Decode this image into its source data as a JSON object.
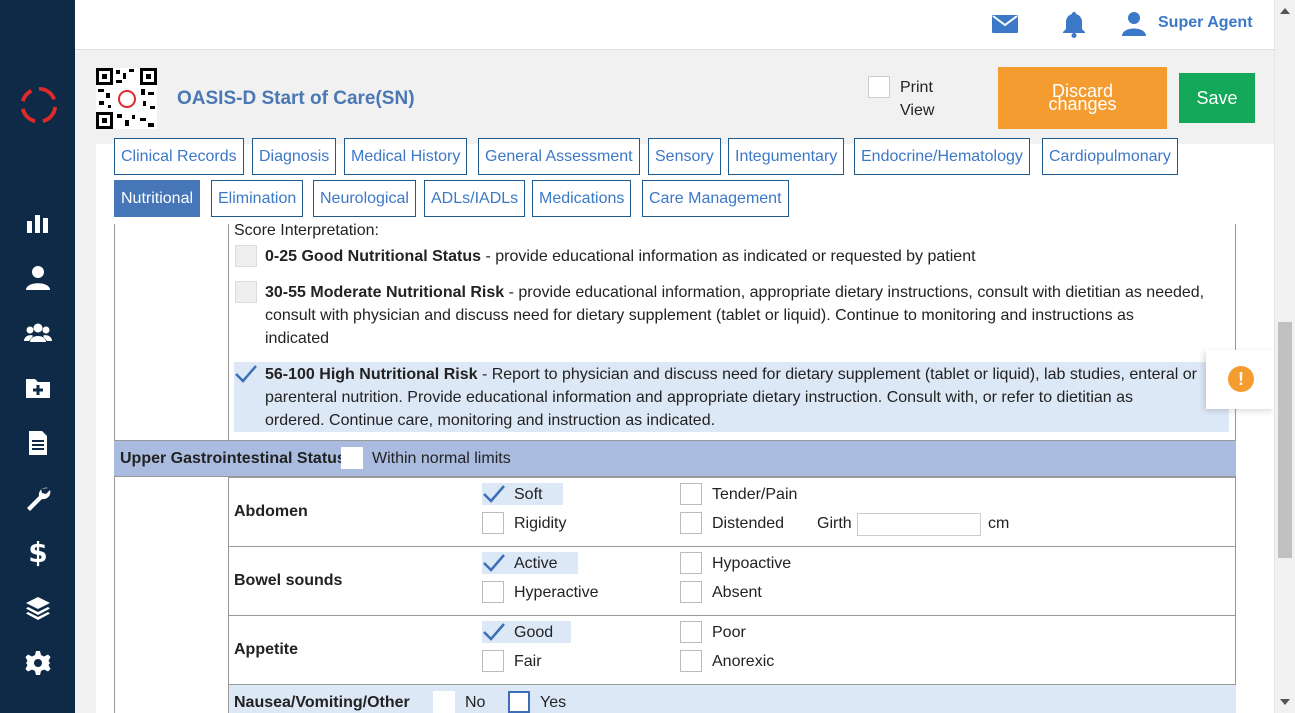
{
  "header": {
    "user_name": "Super Agent"
  },
  "form": {
    "title": "OASIS-D Start of Care(SN)",
    "print_view_label_1": "Print",
    "print_view_label_2": "View",
    "discard_label": "Discard changes",
    "save_label": "Save"
  },
  "tabs": [
    {
      "label": "Clinical Records"
    },
    {
      "label": "Diagnosis"
    },
    {
      "label": "Medical History"
    },
    {
      "label": "General Assessment"
    },
    {
      "label": "Sensory"
    },
    {
      "label": "Integumentary"
    },
    {
      "label": "Endocrine/Hematology"
    },
    {
      "label": "Cardiopulmonary"
    },
    {
      "label": "Nutritional",
      "active": true
    },
    {
      "label": "Elimination"
    },
    {
      "label": "Neurological"
    },
    {
      "label": "ADLs/IADLs"
    },
    {
      "label": "Medications"
    },
    {
      "label": "Care Management"
    }
  ],
  "score": {
    "title": "Score Interpretation:",
    "options": [
      {
        "bold": "0-25 Good Nutritional Status",
        "text": " - provide educational information as indicated or requested by patient",
        "checked": false
      },
      {
        "bold": "30-55 Moderate Nutritional Risk",
        "text": " - provide educational information, appropriate dietary instructions, consult with dietitian as needed,",
        "line2": "consult with physician and discuss need for dietary supplement (tablet or liquid). Continue to monitoring and instructions as",
        "line3": "indicated",
        "checked": false
      },
      {
        "bold": "56-100 High Nutritional Risk",
        "text": " - Report to physician and discuss need for dietary supplement (tablet or liquid), lab studies, enteral or",
        "line2": "parenteral nutrition. Provide educational information and appropriate dietary instruction. Consult with, or refer to dietitian as",
        "line3": "ordered. Continue care, monitoring and instruction as indicated.",
        "checked": true
      }
    ]
  },
  "upper_gi": {
    "title": "Upper Gastrointestinal Status",
    "wnl_label": "Within normal limits",
    "wnl_checked": false
  },
  "abdomen": {
    "label": "Abdomen",
    "opt1": "Soft",
    "opt1_checked": true,
    "opt2": "Rigidity",
    "opt3": "Tender/Pain",
    "opt4": "Distended",
    "girth_label": "Girth",
    "girth_value": "",
    "girth_unit": "cm"
  },
  "bowel": {
    "label": "Bowel sounds",
    "opt1": "Active",
    "opt1_checked": true,
    "opt2": "Hyperactive",
    "opt3": "Hypoactive",
    "opt4": "Absent"
  },
  "appetite": {
    "label": "Appetite",
    "opt1": "Good",
    "opt1_checked": true,
    "opt2": "Fair",
    "opt3": "Poor",
    "opt4": "Anorexic"
  },
  "nausea": {
    "label": "Nausea/Vomiting/Other",
    "no_label": "No",
    "yes_label": "Yes"
  },
  "colors": {
    "sidebar": "#0e2a47",
    "accent_blue": "#3c78c8",
    "discard_orange": "#f49c30",
    "save_green": "#14a85a",
    "section_bar": "#a9bcdf"
  }
}
